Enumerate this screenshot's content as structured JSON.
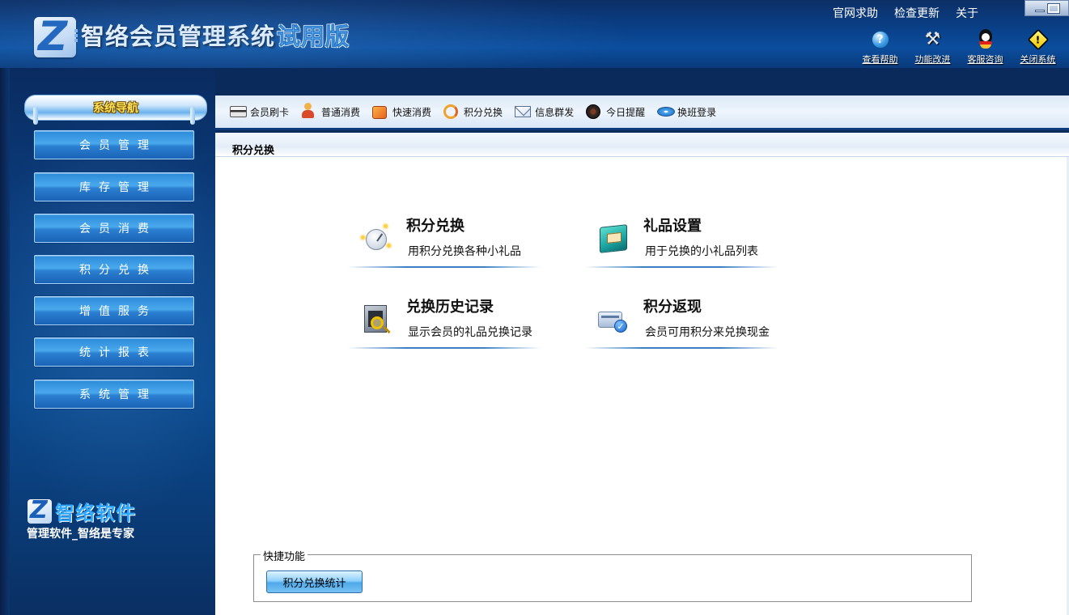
{
  "app": {
    "title": "智络会员管理系统",
    "edition": "试用版"
  },
  "top_links": [
    "官网求助",
    "检查更新",
    "关于"
  ],
  "tools": [
    {
      "label": "查看帮助",
      "icon": "help-icon"
    },
    {
      "label": "功能改进",
      "icon": "tools-icon"
    },
    {
      "label": "客服咨询",
      "icon": "qq-icon"
    },
    {
      "label": "关闭系统",
      "icon": "warning-icon"
    }
  ],
  "sidebar": {
    "header": "系统导航",
    "items": [
      "会员管理",
      "库存管理",
      "会员消费",
      "积分兑换",
      "增值服务",
      "统计报表",
      "系统管理"
    ],
    "brand": "智络软件",
    "slogan": "管理软件_智络是专家"
  },
  "toolbar": {
    "items": [
      {
        "label": "会员刷卡",
        "icon": "card-icon"
      },
      {
        "label": "普通消费",
        "icon": "person-icon"
      },
      {
        "label": "快速消费",
        "icon": "shopping-icon"
      },
      {
        "label": "积分兑换",
        "icon": "exchange-icon"
      },
      {
        "label": "信息群发",
        "icon": "mail-icon"
      },
      {
        "label": "今日提醒",
        "icon": "clock-icon"
      },
      {
        "label": "换班登录",
        "icon": "disk-icon"
      }
    ]
  },
  "content": {
    "section_title": "积分兑换",
    "features": [
      {
        "title": "积分兑换",
        "desc": "用积分兑换各种小礼品",
        "icon": "points-exchange-icon"
      },
      {
        "title": "礼品设置",
        "desc": "用于兑换的小礼品列表",
        "icon": "gift-box-icon"
      },
      {
        "title": "兑换历史记录",
        "desc": "显示会员的礼品兑换记录",
        "icon": "history-search-icon"
      },
      {
        "title": "积分返现",
        "desc": "会员可用积分来兑换现金",
        "icon": "cashback-card-icon"
      }
    ],
    "quick": {
      "legend": "快捷功能",
      "button": "积分兑换统计"
    }
  }
}
